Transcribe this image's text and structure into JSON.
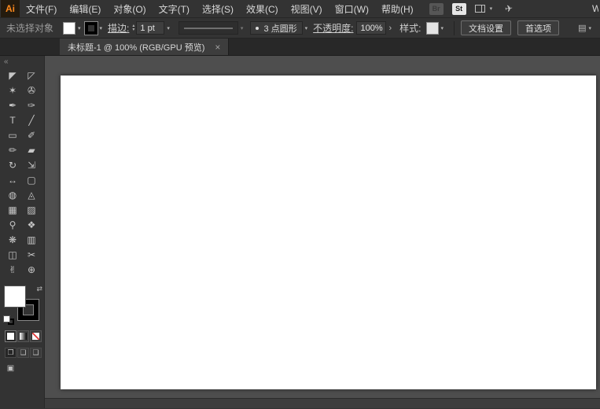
{
  "app": {
    "clipped_right_text": "W"
  },
  "menubar": {
    "logo_text": "Ai",
    "items": [
      "文件(F)",
      "编辑(E)",
      "对象(O)",
      "文字(T)",
      "选择(S)",
      "效果(C)",
      "视图(V)",
      "窗口(W)",
      "帮助(H)"
    ],
    "bridge_label": "Br",
    "stock_label": "St"
  },
  "controlbar": {
    "no_selection_label": "未选择对象",
    "stroke_link": "描边:",
    "stroke_weight_value": "1 pt",
    "brush_definition_value": "3 点圆形",
    "opacity_link": "不透明度:",
    "opacity_value": "100%",
    "style_label": "样式:",
    "document_setup_label": "文档设置",
    "preferences_label": "首选项"
  },
  "tab": {
    "title": "未标题-1 @ 100% (RGB/GPU 预览)"
  },
  "toolbar": {
    "collapse_glyph": "«",
    "tools": [
      {
        "name": "selection",
        "glyph": "◤"
      },
      {
        "name": "direct-selection",
        "glyph": "◸"
      },
      {
        "name": "magic-wand",
        "glyph": "✶"
      },
      {
        "name": "lasso",
        "glyph": "✇"
      },
      {
        "name": "pen",
        "glyph": "✒"
      },
      {
        "name": "curvature",
        "glyph": "✑"
      },
      {
        "name": "type",
        "glyph": "T"
      },
      {
        "name": "line-segment",
        "glyph": "╱"
      },
      {
        "name": "rectangle",
        "glyph": "▭"
      },
      {
        "name": "paintbrush",
        "glyph": "✐"
      },
      {
        "name": "shaper",
        "glyph": "✏"
      },
      {
        "name": "eraser",
        "glyph": "▰"
      },
      {
        "name": "rotate",
        "glyph": "↻"
      },
      {
        "name": "scale",
        "glyph": "⇲"
      },
      {
        "name": "width",
        "glyph": "↔"
      },
      {
        "name": "free-transform",
        "glyph": "▢"
      },
      {
        "name": "shape-builder",
        "glyph": "◍"
      },
      {
        "name": "perspective-grid",
        "glyph": "◬"
      },
      {
        "name": "mesh",
        "glyph": "▦"
      },
      {
        "name": "gradient",
        "glyph": "▨"
      },
      {
        "name": "eyedropper",
        "glyph": "⚲"
      },
      {
        "name": "blend",
        "glyph": "❖"
      },
      {
        "name": "symbol-sprayer",
        "glyph": "❋"
      },
      {
        "name": "column-graph",
        "glyph": "▥"
      },
      {
        "name": "artboard",
        "glyph": "◫"
      },
      {
        "name": "slice",
        "glyph": "✂"
      },
      {
        "name": "hand",
        "glyph": "✌"
      },
      {
        "name": "zoom",
        "glyph": "⊕"
      }
    ],
    "drawing_modes": [
      {
        "name": "draw-normal",
        "glyph": "❐"
      },
      {
        "name": "draw-behind",
        "glyph": "❏"
      },
      {
        "name": "draw-inside",
        "glyph": "❑"
      }
    ],
    "screen_mode_glyph": "▣"
  },
  "glyphs": {
    "dropdown": "▾",
    "spinner_up": "▴",
    "spinner_down": "▾",
    "chevron": "›",
    "swap": "⇄",
    "menu_box": "▤",
    "plane": "✈",
    "close": "×"
  },
  "colors": {
    "chrome": "#333333",
    "canvas": "#4e4e4e",
    "artboard": "#ffffff",
    "logo_orange": "#ff8a1d",
    "none_red": "#e03a3a"
  }
}
